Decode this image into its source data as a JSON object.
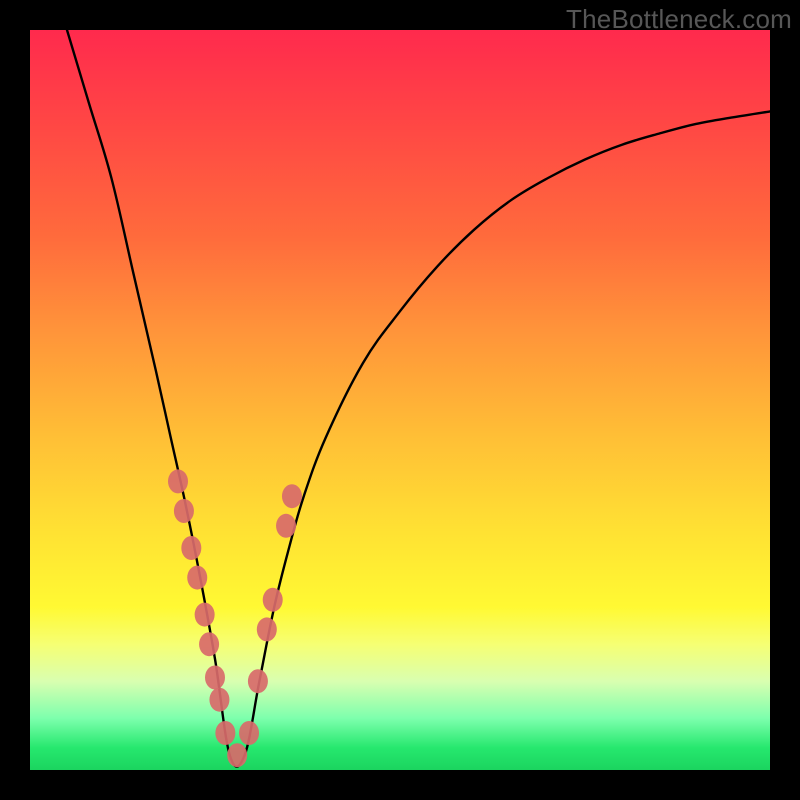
{
  "watermark": "TheBottleneck.com",
  "chart_data": {
    "type": "line",
    "title": "",
    "xlabel": "",
    "ylabel": "",
    "xlim": [
      0,
      100
    ],
    "ylim": [
      0,
      100
    ],
    "notes": "V-shaped bottleneck curve on a vertical green-to-red gradient background. Minimum (best) near x≈27. Red beads mark highlighted data points along the curve near the bottom.",
    "series": [
      {
        "name": "bottleneck-curve",
        "x": [
          5,
          8,
          11,
          14,
          17,
          19,
          21,
          23,
          25,
          27,
          29,
          31,
          33,
          35,
          37,
          40,
          45,
          50,
          55,
          60,
          65,
          70,
          75,
          80,
          85,
          90,
          95,
          100
        ],
        "y": [
          100,
          90,
          80,
          67,
          54,
          45,
          36,
          26,
          15,
          2,
          2,
          12,
          22,
          30,
          37,
          45,
          55,
          62,
          68,
          73,
          77,
          80,
          82.5,
          84.5,
          86,
          87.3,
          88.2,
          89
        ]
      }
    ],
    "highlight_points": {
      "name": "beads",
      "color": "#d86a6a",
      "x": [
        20.0,
        20.8,
        21.8,
        22.6,
        23.6,
        24.2,
        25.0,
        25.6,
        26.4,
        28.0,
        29.6,
        30.8,
        32.0,
        32.8,
        34.6,
        35.4
      ],
      "y": [
        39.0,
        35.0,
        30.0,
        26.0,
        21.0,
        17.0,
        12.5,
        9.5,
        5.0,
        2.0,
        5.0,
        12.0,
        19.0,
        23.0,
        33.0,
        37.0
      ]
    },
    "gradient_stops": [
      {
        "pos": 0.0,
        "color": "#1bd45f"
      },
      {
        "pos": 0.03,
        "color": "#26e86e"
      },
      {
        "pos": 0.07,
        "color": "#7dffad"
      },
      {
        "pos": 0.12,
        "color": "#d9ffb0"
      },
      {
        "pos": 0.17,
        "color": "#f6ff73"
      },
      {
        "pos": 0.22,
        "color": "#fff933"
      },
      {
        "pos": 0.32,
        "color": "#ffe233"
      },
      {
        "pos": 0.45,
        "color": "#ffbf36"
      },
      {
        "pos": 0.6,
        "color": "#ff923a"
      },
      {
        "pos": 0.72,
        "color": "#ff6b3c"
      },
      {
        "pos": 0.88,
        "color": "#ff4545"
      },
      {
        "pos": 1.0,
        "color": "#ff2a4d"
      }
    ]
  }
}
